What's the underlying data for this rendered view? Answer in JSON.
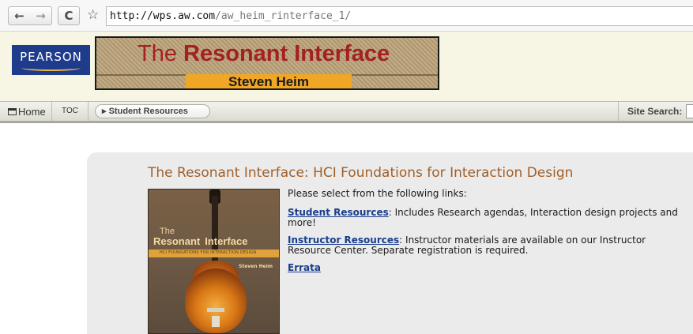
{
  "browser": {
    "back_icon": "back-arrow-icon",
    "forward_icon": "forward-arrow-icon",
    "reload_icon": "reload-icon",
    "bookmark_icon": "star-icon",
    "url_host": "http://wps.aw.com",
    "url_path": "/aw_heim_rinterface_1/"
  },
  "header": {
    "logo_text": "PEARSON",
    "banner_title_prefix": "The",
    "banner_title_main": "Resonant Interface",
    "banner_author": "Steven Heim"
  },
  "navbar": {
    "home_label": "Home",
    "toc_label": "TOC",
    "breadcrumb_label": "Student Resources",
    "site_search_label": "Site Search:"
  },
  "main": {
    "title": "The Resonant Interface: HCI Foundations for Interaction Design",
    "cover": {
      "the": "The",
      "title_a": "Resonant",
      "title_b": "Interface",
      "subtitle": "HCI FOUNDATIONS    FOR INTERACTION DESIGN",
      "author": "Steven Heim"
    },
    "intro": "Please select from the following links:",
    "links": [
      {
        "label": "Student Resources",
        "description": ": Includes Research agendas, Interaction design projects and more!"
      },
      {
        "label": "Instructor Resources",
        "description": ": Instructor materials are available on our Instructor Resource Center. Separate registration is required."
      },
      {
        "label": "Errata",
        "description": ""
      }
    ]
  },
  "colors": {
    "title_color": "#a0602b",
    "link_color": "#1a3e8c",
    "pearson_blue": "#1f3b8b",
    "banner_red": "#a3211f",
    "banner_orange": "#f1a726"
  }
}
